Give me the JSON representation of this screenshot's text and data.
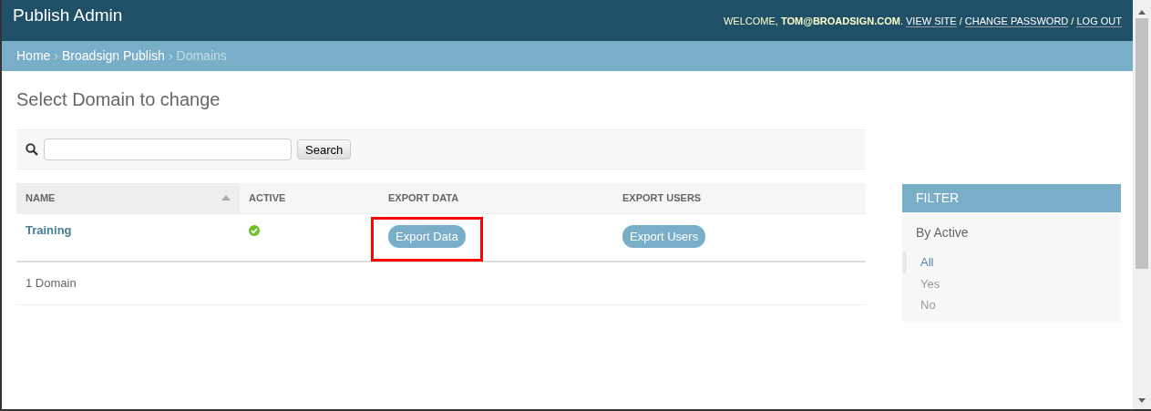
{
  "header": {
    "title": "Publish Admin",
    "welcome": "WELCOME,",
    "user": "TOM@BROADSIGN.COM",
    "user_suffix": ".",
    "links": [
      {
        "label": "VIEW SITE"
      },
      {
        "label": "CHANGE PASSWORD"
      },
      {
        "label": "LOG OUT"
      }
    ],
    "separator": "/"
  },
  "breadcrumbs": [
    {
      "label": "Home",
      "current": false
    },
    {
      "label": "Broadsign Publish",
      "current": false
    },
    {
      "label": "Domains",
      "current": true
    }
  ],
  "breadcrumb_separator": "›",
  "page_title": "Select Domain to change",
  "search": {
    "button": "Search"
  },
  "table": {
    "columns": [
      {
        "label": "NAME",
        "sorted": true
      },
      {
        "label": "ACTIVE",
        "sorted": false
      },
      {
        "label": "EXPORT DATA",
        "sorted": false
      },
      {
        "label": "EXPORT USERS",
        "sorted": false
      }
    ],
    "rows": [
      {
        "name": "Training",
        "active": true,
        "export_data": {
          "label": "Export Data",
          "highlighted": true
        },
        "export_users": {
          "label": "Export Users",
          "highlighted": false
        }
      }
    ]
  },
  "result_count": "1 Domain",
  "filter": {
    "title": "FILTER",
    "group": "By Active",
    "choices": [
      {
        "label": "All",
        "selected": true
      },
      {
        "label": "Yes",
        "selected": false
      },
      {
        "label": "No",
        "selected": false
      }
    ]
  }
}
